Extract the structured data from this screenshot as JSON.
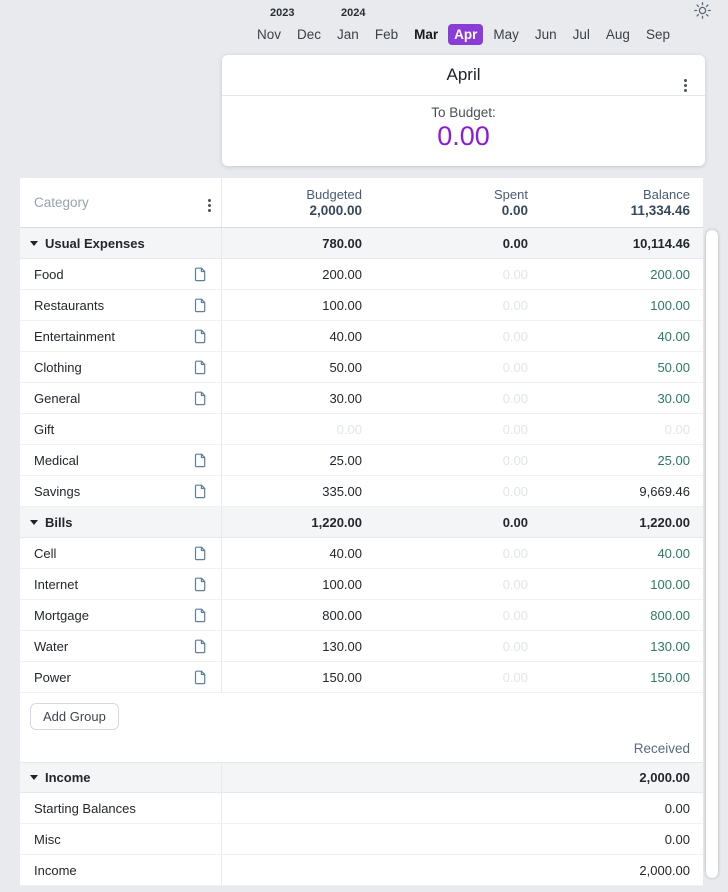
{
  "theme_toggle": {
    "icon": "sun-icon"
  },
  "month_nav": {
    "years": [
      {
        "label": "2023"
      },
      {
        "label": "2024"
      }
    ],
    "months": [
      "Nov",
      "Dec",
      "Jan",
      "Feb",
      "Mar",
      "Apr",
      "May",
      "Jun",
      "Jul",
      "Aug",
      "Sep"
    ],
    "selected_month": "Apr",
    "emphasized_month": "Mar"
  },
  "summary_card": {
    "title": "April",
    "to_budget_label": "To Budget:",
    "to_budget_amount": "0.00"
  },
  "table": {
    "category_header": "Category",
    "columns": [
      {
        "label": "Budgeted",
        "total": "2,000.00"
      },
      {
        "label": "Spent",
        "total": "0.00"
      },
      {
        "label": "Balance",
        "total": "11,334.46"
      }
    ],
    "groups": [
      {
        "name": "Usual Expenses",
        "budgeted": {
          "v": "780.00",
          "style": "bold"
        },
        "spent": {
          "v": "0.00",
          "style": "bold"
        },
        "balance": {
          "v": "10,114.46",
          "style": "bold"
        },
        "rows": [
          {
            "name": "Food",
            "has_note_icon": true,
            "budgeted": {
              "v": "200.00",
              "style": "dark"
            },
            "spent": {
              "v": "0.00",
              "style": "muted"
            },
            "balance": {
              "v": "200.00",
              "style": "green"
            }
          },
          {
            "name": "Restaurants",
            "has_note_icon": true,
            "budgeted": {
              "v": "100.00",
              "style": "dark"
            },
            "spent": {
              "v": "0.00",
              "style": "muted"
            },
            "balance": {
              "v": "100.00",
              "style": "green"
            }
          },
          {
            "name": "Entertainment",
            "has_note_icon": true,
            "budgeted": {
              "v": "40.00",
              "style": "dark"
            },
            "spent": {
              "v": "0.00",
              "style": "muted"
            },
            "balance": {
              "v": "40.00",
              "style": "green"
            }
          },
          {
            "name": "Clothing",
            "has_note_icon": true,
            "budgeted": {
              "v": "50.00",
              "style": "dark"
            },
            "spent": {
              "v": "0.00",
              "style": "muted"
            },
            "balance": {
              "v": "50.00",
              "style": "green"
            }
          },
          {
            "name": "General",
            "has_note_icon": true,
            "budgeted": {
              "v": "30.00",
              "style": "dark"
            },
            "spent": {
              "v": "0.00",
              "style": "muted"
            },
            "balance": {
              "v": "30.00",
              "style": "green"
            }
          },
          {
            "name": "Gift",
            "has_note_icon": false,
            "budgeted": {
              "v": "0.00",
              "style": "muted"
            },
            "spent": {
              "v": "0.00",
              "style": "muted"
            },
            "balance": {
              "v": "0.00",
              "style": "muted"
            }
          },
          {
            "name": "Medical",
            "has_note_icon": true,
            "budgeted": {
              "v": "25.00",
              "style": "dark"
            },
            "spent": {
              "v": "0.00",
              "style": "muted"
            },
            "balance": {
              "v": "25.00",
              "style": "green"
            }
          },
          {
            "name": "Savings",
            "has_note_icon": true,
            "budgeted": {
              "v": "335.00",
              "style": "dark"
            },
            "spent": {
              "v": "0.00",
              "style": "muted"
            },
            "balance": {
              "v": "9,669.46",
              "style": "dark"
            }
          }
        ]
      },
      {
        "name": "Bills",
        "budgeted": {
          "v": "1,220.00",
          "style": "bold"
        },
        "spent": {
          "v": "0.00",
          "style": "bold"
        },
        "balance": {
          "v": "1,220.00",
          "style": "bold"
        },
        "rows": [
          {
            "name": "Cell",
            "has_note_icon": true,
            "budgeted": {
              "v": "40.00",
              "style": "dark"
            },
            "spent": {
              "v": "0.00",
              "style": "muted"
            },
            "balance": {
              "v": "40.00",
              "style": "green"
            }
          },
          {
            "name": "Internet",
            "has_note_icon": true,
            "budgeted": {
              "v": "100.00",
              "style": "dark"
            },
            "spent": {
              "v": "0.00",
              "style": "muted"
            },
            "balance": {
              "v": "100.00",
              "style": "green"
            }
          },
          {
            "name": "Mortgage",
            "has_note_icon": true,
            "budgeted": {
              "v": "800.00",
              "style": "dark"
            },
            "spent": {
              "v": "0.00",
              "style": "muted"
            },
            "balance": {
              "v": "800.00",
              "style": "green"
            }
          },
          {
            "name": "Water",
            "has_note_icon": true,
            "budgeted": {
              "v": "130.00",
              "style": "dark"
            },
            "spent": {
              "v": "0.00",
              "style": "muted"
            },
            "balance": {
              "v": "130.00",
              "style": "green"
            }
          },
          {
            "name": "Power",
            "has_note_icon": true,
            "budgeted": {
              "v": "150.00",
              "style": "dark"
            },
            "spent": {
              "v": "0.00",
              "style": "muted"
            },
            "balance": {
              "v": "150.00",
              "style": "green"
            }
          }
        ]
      }
    ],
    "add_group_label": "Add Group",
    "received_label": "Received",
    "income_section": {
      "group_name": "Income",
      "group_received": "2,000.00",
      "rows": [
        {
          "name": "Starting Balances",
          "received": "0.00"
        },
        {
          "name": "Misc",
          "received": "0.00"
        },
        {
          "name": "Income",
          "received": "2,000.00"
        }
      ]
    }
  },
  "colors": {
    "accent_purple": "#8a3bd8",
    "to_budget_purple": "#8a1bd8",
    "balance_green": "#2c7a62",
    "header_slate": "#35485e",
    "muted_value": "#e2e5e9",
    "page_background": "#e8eaed"
  }
}
